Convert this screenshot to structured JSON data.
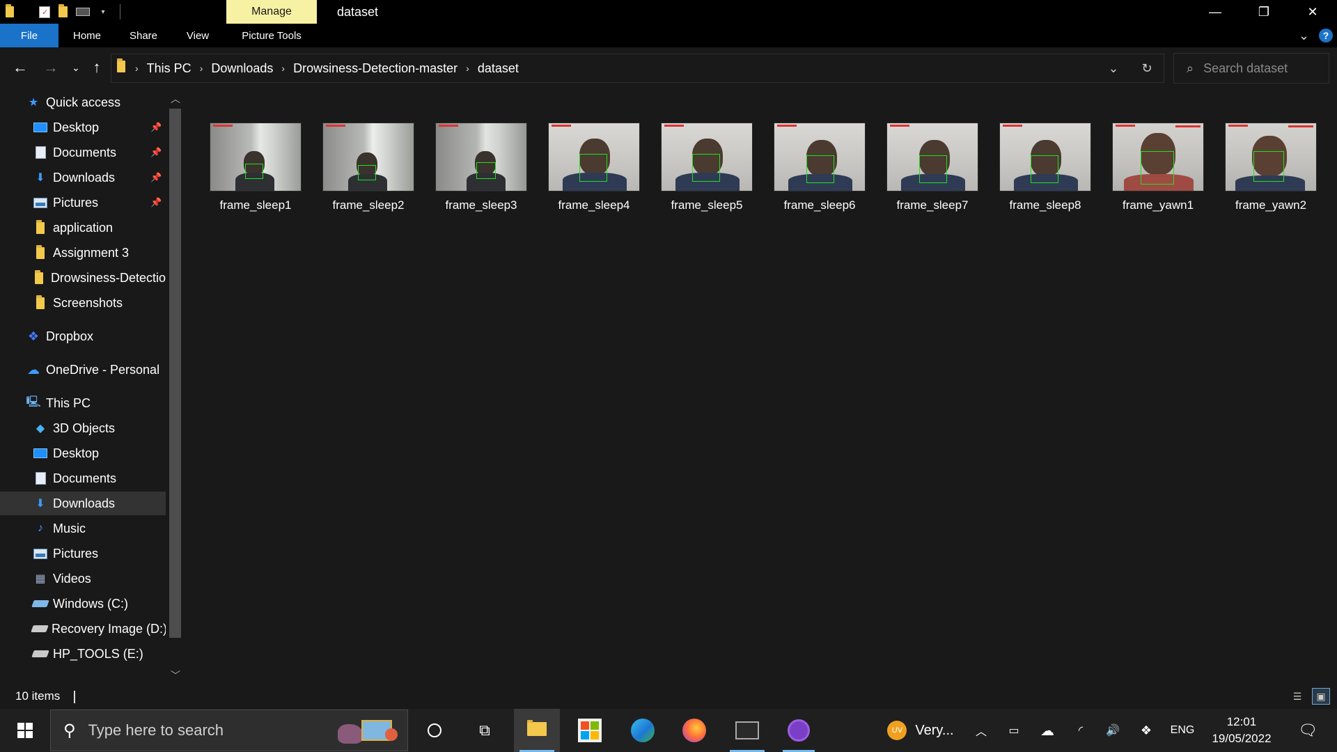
{
  "window": {
    "title": "dataset",
    "contextual_tab": "Manage",
    "controls": {
      "minimize": "—",
      "restore": "❐",
      "close": "✕"
    }
  },
  "ribbon": {
    "tabs": [
      "File",
      "Home",
      "Share",
      "View",
      "Picture Tools"
    ],
    "help": "?"
  },
  "address": {
    "breadcrumb": [
      "This PC",
      "Downloads",
      "Drowsiness-Detection-master",
      "dataset"
    ],
    "search_placeholder": "Search dataset"
  },
  "nav_pane": {
    "items": [
      {
        "label": "Quick access",
        "icon": "star-icon"
      },
      {
        "label": "Desktop",
        "icon": "desktop-icon",
        "pinned": true
      },
      {
        "label": "Documents",
        "icon": "documents-icon",
        "pinned": true
      },
      {
        "label": "Downloads",
        "icon": "downloads-icon",
        "pinned": true
      },
      {
        "label": "Pictures",
        "icon": "pictures-icon",
        "pinned": true
      },
      {
        "label": "application",
        "icon": "folder-icon"
      },
      {
        "label": "Assignment 3",
        "icon": "folder-icon"
      },
      {
        "label": "Drowsiness-Detectio",
        "icon": "folder-icon"
      },
      {
        "label": "Screenshots",
        "icon": "folder-icon"
      },
      {
        "label": "Dropbox",
        "icon": "dropbox-icon"
      },
      {
        "label": "OneDrive - Personal",
        "icon": "onedrive-icon"
      },
      {
        "label": "This PC",
        "icon": "computer-icon"
      },
      {
        "label": "3D Objects",
        "icon": "3d-objects-icon"
      },
      {
        "label": "Desktop",
        "icon": "desktop-icon"
      },
      {
        "label": "Documents",
        "icon": "documents-icon"
      },
      {
        "label": "Downloads",
        "icon": "downloads-icon",
        "selected": true
      },
      {
        "label": "Music",
        "icon": "music-icon"
      },
      {
        "label": "Pictures",
        "icon": "pictures-icon"
      },
      {
        "label": "Videos",
        "icon": "videos-icon"
      },
      {
        "label": "Windows (C:)",
        "icon": "drive-icon"
      },
      {
        "label": "Recovery Image (D:)",
        "icon": "drive-icon"
      },
      {
        "label": "HP_TOOLS (E:)",
        "icon": "drive-icon"
      }
    ]
  },
  "files": [
    {
      "name": "frame_sleep1",
      "scene": "window"
    },
    {
      "name": "frame_sleep2",
      "scene": "window"
    },
    {
      "name": "frame_sleep3",
      "scene": "window"
    },
    {
      "name": "frame_sleep4",
      "scene": "face"
    },
    {
      "name": "frame_sleep5",
      "scene": "face"
    },
    {
      "name": "frame_sleep6",
      "scene": "face"
    },
    {
      "name": "frame_sleep7",
      "scene": "face"
    },
    {
      "name": "frame_sleep8",
      "scene": "face"
    },
    {
      "name": "frame_yawn1",
      "scene": "alert"
    },
    {
      "name": "frame_yawn2",
      "scene": "alert"
    }
  ],
  "status": {
    "item_count": "10 items"
  },
  "taskbar": {
    "search_placeholder": "Type here to search",
    "weather": "Very...",
    "language": "ENG",
    "time": "12:01",
    "date": "19/05/2022"
  },
  "colors": {
    "accent": "#1a73c9",
    "manage_tab": "#f7f1a3",
    "background": "#191919",
    "detection_box": "#1ee31e"
  }
}
